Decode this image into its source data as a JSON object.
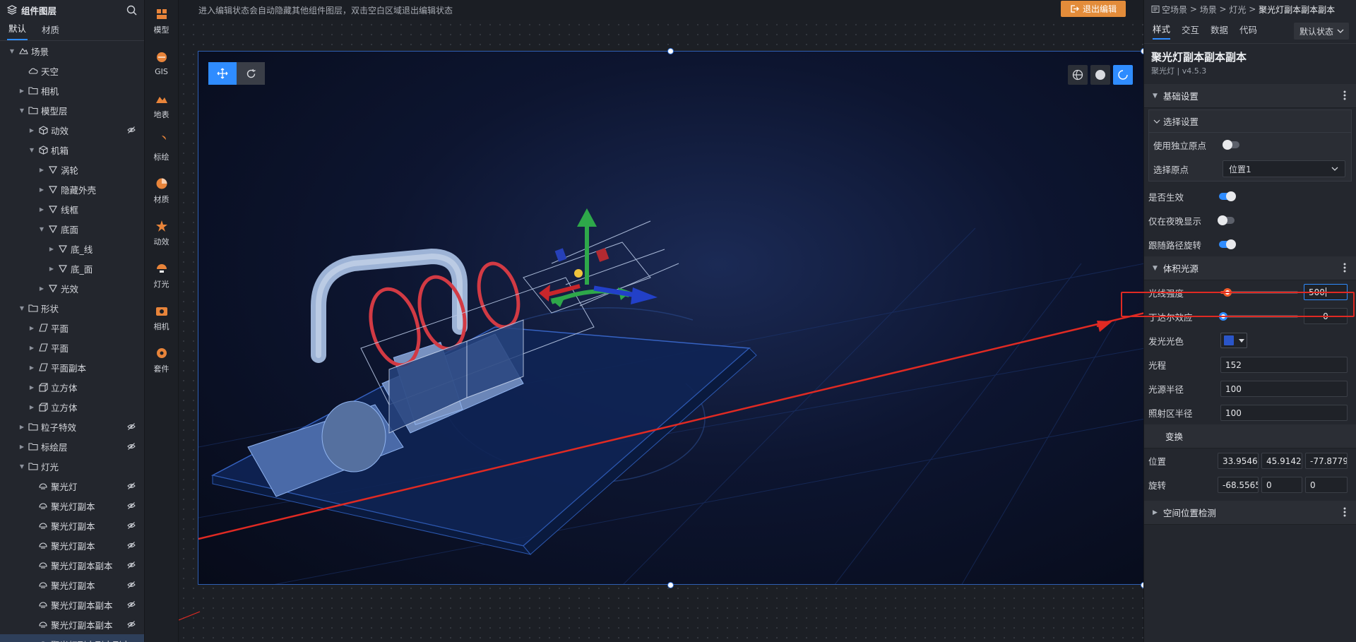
{
  "left_panel": {
    "title": "组件图层",
    "tabs": [
      "默认",
      "材质"
    ],
    "tree": [
      {
        "label": "场景",
        "depth": 0,
        "icon": "scene",
        "expanded": true,
        "eye": false
      },
      {
        "label": "天空",
        "depth": 1,
        "icon": "sky",
        "expanded": null,
        "eye": false
      },
      {
        "label": "相机",
        "depth": 1,
        "icon": "folder",
        "expanded": false,
        "eye": false
      },
      {
        "label": "模型层",
        "depth": 1,
        "icon": "folder",
        "expanded": true,
        "eye": false
      },
      {
        "label": "动效",
        "depth": 2,
        "icon": "cube",
        "expanded": false,
        "eye": true
      },
      {
        "label": "机箱",
        "depth": 2,
        "icon": "cube",
        "expanded": true,
        "eye": false
      },
      {
        "label": "涡轮",
        "depth": 3,
        "icon": "mesh",
        "expanded": false,
        "eye": false
      },
      {
        "label": "隐藏外壳",
        "depth": 3,
        "icon": "mesh",
        "expanded": false,
        "eye": false
      },
      {
        "label": "线框",
        "depth": 3,
        "icon": "mesh",
        "expanded": false,
        "eye": false
      },
      {
        "label": "底面",
        "depth": 3,
        "icon": "mesh",
        "expanded": true,
        "eye": false
      },
      {
        "label": "底_线",
        "depth": 4,
        "icon": "mesh",
        "expanded": false,
        "eye": false
      },
      {
        "label": "底_面",
        "depth": 4,
        "icon": "mesh",
        "expanded": false,
        "eye": false
      },
      {
        "label": "光效",
        "depth": 3,
        "icon": "mesh",
        "expanded": false,
        "eye": false
      },
      {
        "label": "形状",
        "depth": 1,
        "icon": "folder",
        "expanded": true,
        "eye": false
      },
      {
        "label": "平面",
        "depth": 2,
        "icon": "plane",
        "expanded": false,
        "eye": false
      },
      {
        "label": "平面",
        "depth": 2,
        "icon": "plane",
        "expanded": false,
        "eye": false
      },
      {
        "label": "平面副本",
        "depth": 2,
        "icon": "plane",
        "expanded": false,
        "eye": false
      },
      {
        "label": "立方体",
        "depth": 2,
        "icon": "box",
        "expanded": false,
        "eye": false
      },
      {
        "label": "立方体",
        "depth": 2,
        "icon": "box",
        "expanded": false,
        "eye": false
      },
      {
        "label": "粒子特效",
        "depth": 1,
        "icon": "folder",
        "expanded": false,
        "eye": true
      },
      {
        "label": "标绘层",
        "depth": 1,
        "icon": "folder",
        "expanded": false,
        "eye": true
      },
      {
        "label": "灯光",
        "depth": 1,
        "icon": "folder",
        "expanded": true,
        "eye": false
      },
      {
        "label": "聚光灯",
        "depth": 2,
        "icon": "light",
        "expanded": null,
        "eye": true
      },
      {
        "label": "聚光灯副本",
        "depth": 2,
        "icon": "light",
        "expanded": null,
        "eye": true
      },
      {
        "label": "聚光灯副本",
        "depth": 2,
        "icon": "light",
        "expanded": null,
        "eye": true
      },
      {
        "label": "聚光灯副本",
        "depth": 2,
        "icon": "light",
        "expanded": null,
        "eye": true
      },
      {
        "label": "聚光灯副本副本",
        "depth": 2,
        "icon": "light",
        "expanded": null,
        "eye": true
      },
      {
        "label": "聚光灯副本",
        "depth": 2,
        "icon": "light",
        "expanded": null,
        "eye": true
      },
      {
        "label": "聚光灯副本副本",
        "depth": 2,
        "icon": "light",
        "expanded": null,
        "eye": true
      },
      {
        "label": "聚光灯副本副本",
        "depth": 2,
        "icon": "light",
        "expanded": null,
        "eye": true
      },
      {
        "label": "聚光灯副本副本副本",
        "depth": 2,
        "icon": "light",
        "expanded": null,
        "eye": false,
        "selected": true
      }
    ]
  },
  "icon_bar": [
    {
      "label": "模型",
      "icon": "model-icon",
      "color": "#e8843a"
    },
    {
      "label": "GIS",
      "icon": "gis-icon",
      "color": "#e8843a"
    },
    {
      "label": "地表",
      "icon": "terrain-icon",
      "color": "#e8843a"
    },
    {
      "label": "标绘",
      "icon": "marker-icon",
      "color": "#e8843a"
    },
    {
      "label": "材质",
      "icon": "material-icon",
      "color": "#e8843a"
    },
    {
      "label": "动效",
      "icon": "effect-icon",
      "color": "#e8843a"
    },
    {
      "label": "灯光",
      "icon": "light-icon",
      "color": "#e8843a"
    },
    {
      "label": "相机",
      "icon": "camera-icon",
      "color": "#e8843a"
    },
    {
      "label": "套件",
      "icon": "kit-icon",
      "color": "#e8843a"
    }
  ],
  "top": {
    "hint": "进入编辑状态会自动隐藏其他组件图层，双击空白区域退出编辑状态",
    "exit_label": "退出编辑"
  },
  "right_panel": {
    "breadcrumb": {
      "items": [
        "空场景",
        "场景",
        "灯光"
      ],
      "current": "聚光灯副本副本副本"
    },
    "tabs": [
      "样式",
      "交互",
      "数据",
      "代码"
    ],
    "active_tab": "样式",
    "state_select": "默认状态",
    "component_name": "聚光灯副本副本副本",
    "component_sub": "聚光灯 | v4.5.3",
    "section_basic": "基础设置",
    "select_settings": {
      "title": "选择设置",
      "use_origin_label": "使用独立原点",
      "use_origin": false,
      "origin_label": "选择原点",
      "origin_value": "位置1"
    },
    "enabled_label": "是否生效",
    "enabled": true,
    "night_label": "仅在夜晚显示",
    "night": false,
    "follow_label": "跟随路径旋转",
    "follow": true,
    "section_volume": "体积光源",
    "intensity": {
      "label": "光线强度",
      "value": "500",
      "fraction": 0.09
    },
    "tyndall": {
      "label": "丁达尔效应",
      "value": "0",
      "fraction": 0.0
    },
    "color": {
      "label": "发光光色",
      "value": "#2a55c9"
    },
    "range": {
      "label": "光程",
      "value": "152"
    },
    "radius": {
      "label": "光源半径",
      "value": "100"
    },
    "area_radius": {
      "label": "照射区半径",
      "value": "100"
    },
    "section_transform": "变换",
    "position": {
      "label": "位置",
      "values": [
        "33.954673",
        "45.914295",
        "-77.877998"
      ]
    },
    "rotation": {
      "label": "旋转",
      "values": [
        "-68.556509",
        "0",
        "0"
      ]
    },
    "section_space": "空间位置检测"
  },
  "colors": {
    "accent": "#2f8cff",
    "exit": "#e38c3a",
    "highlight": "#e02a23",
    "slider_active": "#f05a2a"
  }
}
